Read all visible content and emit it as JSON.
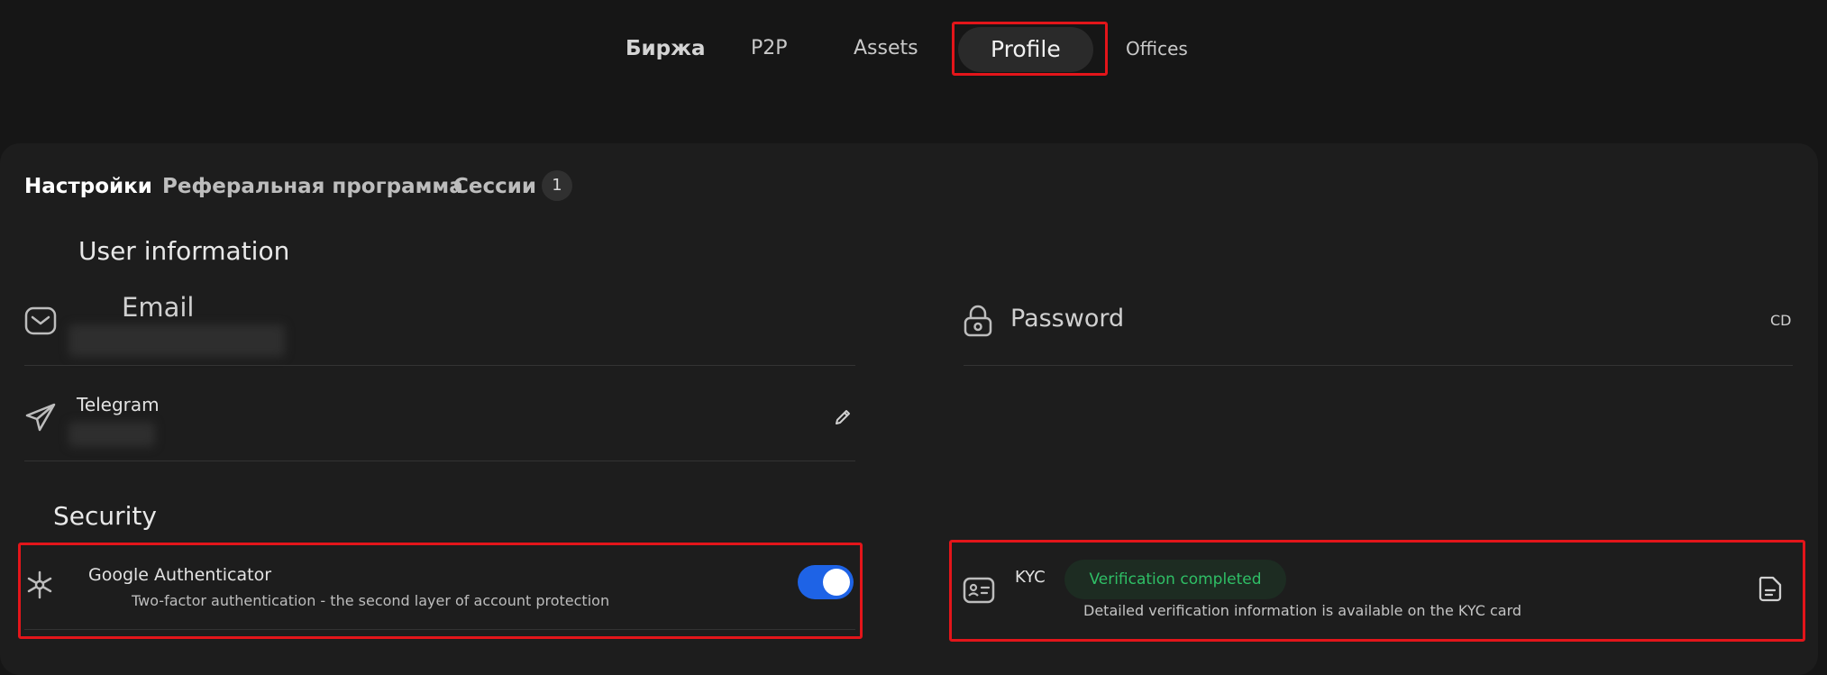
{
  "nav": {
    "items": [
      {
        "label": "Биржа"
      },
      {
        "label": "P2P"
      },
      {
        "label": "Assets"
      },
      {
        "label": "Profile"
      },
      {
        "label": "Offices"
      }
    ],
    "active": "Profile"
  },
  "subtabs": {
    "settings": "Настройки",
    "referral": "Реферальная программа",
    "sessions": "Сессии",
    "sessions_count": "1"
  },
  "user_info": {
    "title": "User information",
    "email_label": "Email",
    "telegram_label": "Telegram",
    "password_label": "Password",
    "password_action": "CD"
  },
  "security": {
    "title": "Security",
    "google_auth": {
      "title": "Google Authenticator",
      "description": "Two-factor authentication - the second layer of account protection",
      "enabled": true
    },
    "kyc": {
      "title": "KYC",
      "status": "Verification completed",
      "description": "Detailed verification information is available on the KYC card"
    }
  },
  "colors": {
    "background": "#161616",
    "panel": "#1d1d1d",
    "toggle_on": "#1e63e6",
    "status_green": "#2fbf66",
    "highlight": "#e3151a"
  }
}
